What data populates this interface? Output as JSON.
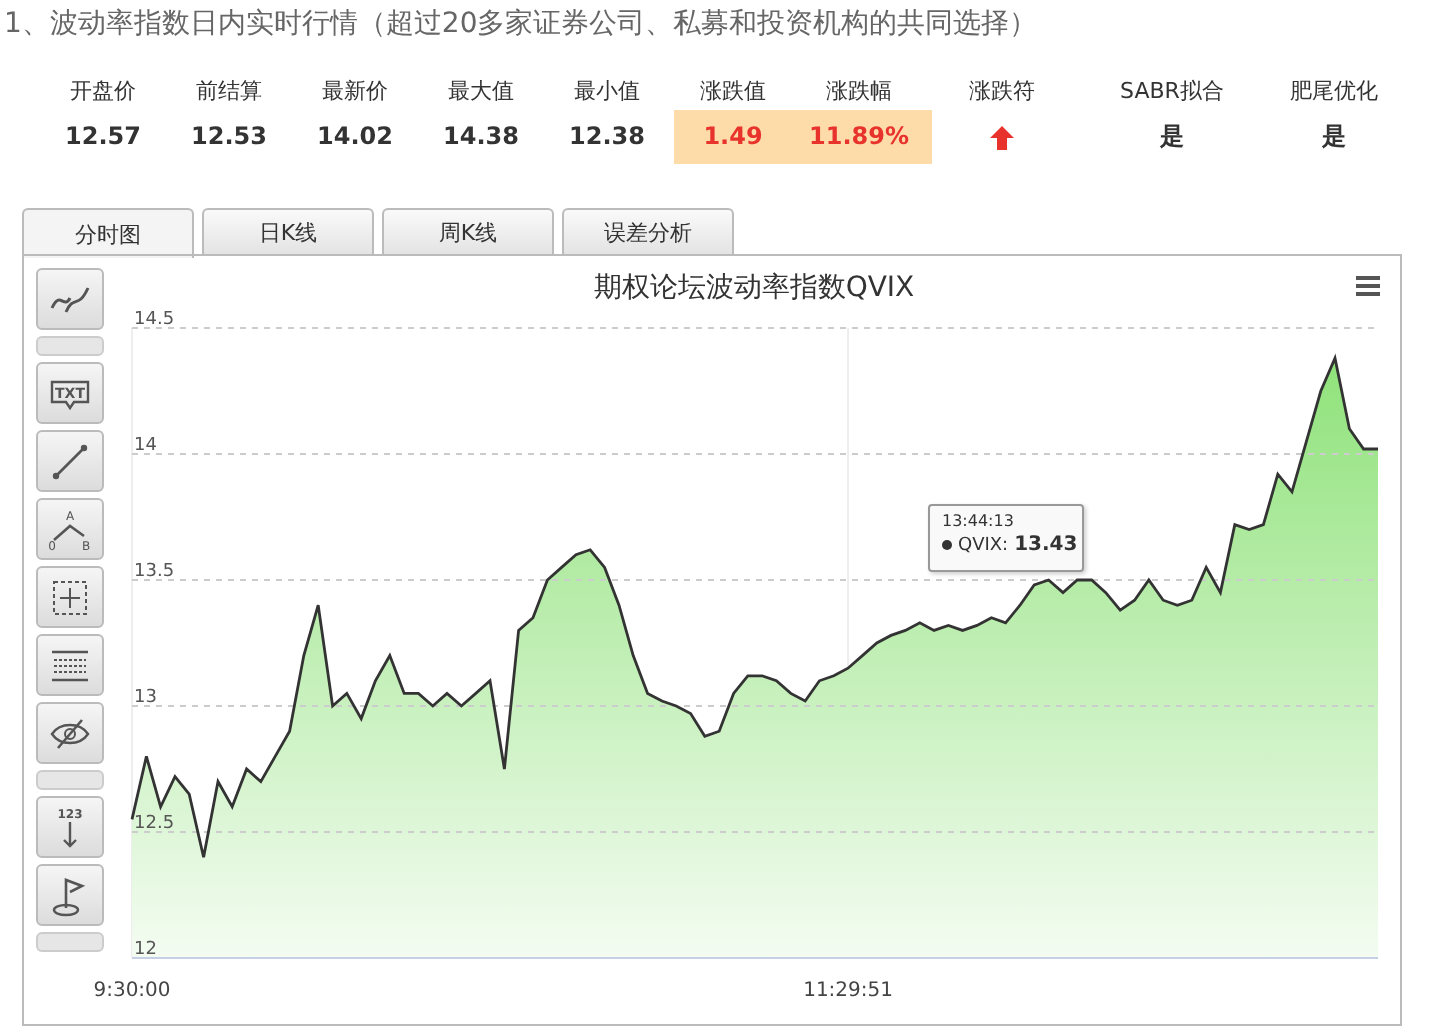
{
  "heading": "1、波动率指数日内实时行情（超过20多家证券公司、私募和投资机构的共同选择）",
  "stats": [
    {
      "label": "开盘价",
      "value": "12.57",
      "kind": "text",
      "highlight": false
    },
    {
      "label": "前结算",
      "value": "12.53",
      "kind": "text",
      "highlight": false
    },
    {
      "label": "最新价",
      "value": "14.02",
      "kind": "text",
      "highlight": false
    },
    {
      "label": "最大值",
      "value": "14.38",
      "kind": "text",
      "highlight": false
    },
    {
      "label": "最小值",
      "value": "12.38",
      "kind": "text",
      "highlight": false
    },
    {
      "label": "涨跌值",
      "value": "1.49",
      "kind": "text",
      "highlight": true
    },
    {
      "label": "涨跌幅",
      "value": "11.89%",
      "kind": "text",
      "highlight": true
    },
    {
      "label": "涨跌符",
      "kind": "up-arrow",
      "highlight": false
    },
    {
      "label": "SABR拟合",
      "value": "是",
      "kind": "text",
      "highlight": false
    },
    {
      "label": "肥尾优化",
      "value": "是",
      "kind": "text",
      "highlight": false
    }
  ],
  "tabs": [
    {
      "label": "分时图",
      "selected": true
    },
    {
      "label": "日K线",
      "selected": false
    },
    {
      "label": "周K线",
      "selected": false
    },
    {
      "label": "误差分析",
      "selected": false
    }
  ],
  "tools": [
    {
      "kind": "trend"
    },
    {
      "kind": "separator"
    },
    {
      "kind": "text-note",
      "text": "TXT"
    },
    {
      "kind": "line"
    },
    {
      "kind": "angle",
      "labels": [
        "A",
        "0",
        "B"
      ]
    },
    {
      "kind": "crosshair"
    },
    {
      "kind": "grid"
    },
    {
      "kind": "hide"
    },
    {
      "kind": "separator"
    },
    {
      "kind": "number",
      "text": "123"
    },
    {
      "kind": "flag"
    },
    {
      "kind": "separator"
    }
  ],
  "chart": {
    "tooltip": {
      "time": "13:44:13",
      "series": "QVIX:",
      "value": "13.43"
    },
    "chart_data": {
      "type": "area",
      "title": "期权论坛波动率指数QVIX",
      "categories": [
        "9:30:00",
        null,
        null,
        null,
        null,
        null,
        null,
        null,
        null,
        null,
        null,
        null,
        null,
        null,
        null,
        null,
        null,
        null,
        null,
        null,
        null,
        null,
        null,
        null,
        null,
        null,
        null,
        null,
        null,
        null,
        null,
        null,
        null,
        null,
        null,
        null,
        null,
        null,
        null,
        null,
        null,
        null,
        null,
        null,
        null,
        null,
        null,
        null,
        null,
        null,
        "11:29:51",
        null,
        null,
        null,
        null,
        null,
        null,
        null,
        null,
        null,
        null,
        null,
        null,
        null,
        null,
        null,
        null,
        null,
        null,
        null,
        null,
        null,
        null,
        null,
        null,
        null,
        null,
        null,
        null,
        null,
        null,
        null,
        null,
        null,
        null,
        null,
        null,
        null
      ],
      "series": [
        {
          "color": "#333333",
          "values": [
            12.55,
            12.8,
            12.6,
            12.72,
            12.65,
            12.4,
            12.7,
            12.6,
            12.75,
            12.7,
            12.8,
            12.9,
            13.2,
            13.4,
            13.0,
            13.05,
            12.95,
            13.1,
            13.2,
            13.05,
            13.05,
            13.0,
            13.05,
            13.0,
            13.05,
            13.1,
            12.75,
            13.3,
            13.35,
            13.5,
            13.55,
            13.6,
            13.62,
            13.55,
            13.4,
            13.2,
            13.05,
            13.02,
            13.0,
            12.97,
            12.88,
            12.9,
            13.05,
            13.12,
            13.12,
            13.1,
            13.05,
            13.02,
            13.1,
            13.12,
            13.15,
            13.2,
            13.25,
            13.28,
            13.3,
            13.33,
            13.3,
            13.32,
            13.3,
            13.32,
            13.35,
            13.33,
            13.4,
            13.48,
            13.5,
            13.45,
            13.5,
            13.5,
            13.45,
            13.38,
            13.42,
            13.5,
            13.42,
            13.4,
            13.42,
            13.55,
            13.45,
            13.72,
            13.7,
            13.72,
            13.92,
            13.85,
            14.05,
            14.25,
            14.38,
            14.1,
            14.02,
            14.02
          ]
        }
      ],
      "ylim": [
        12,
        14.5
      ],
      "grid": true,
      "yticks": [
        {
          "value": 12,
          "label": "12"
        },
        {
          "value": 12.5,
          "label": "12.5"
        },
        {
          "value": 13,
          "label": "13"
        },
        {
          "value": 13.5,
          "label": "13.5"
        },
        {
          "value": 14,
          "label": "14"
        },
        {
          "value": 14.5,
          "label": "14.5"
        }
      ]
    }
  }
}
